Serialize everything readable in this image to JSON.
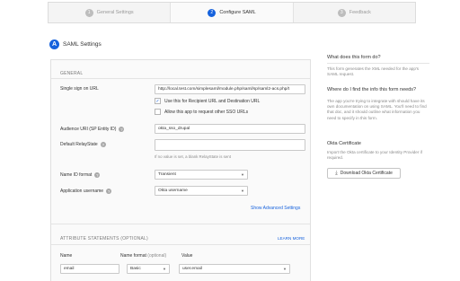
{
  "steps": [
    {
      "num": "1",
      "label": "General Settings"
    },
    {
      "num": "2",
      "label": "Configure SAML"
    },
    {
      "num": "3",
      "label": "Feedback"
    }
  ],
  "header": {
    "badge": "A",
    "title": "SAML Settings"
  },
  "general": {
    "title": "GENERAL",
    "sso_url": {
      "label": "Single sign on URL",
      "value": "http://local.test.com/simplesaml/module.php/saml/sp/saml2-acs.php/t"
    },
    "recipient_check": {
      "checked": true,
      "label": "Use this for Recipient URL and Destination URL"
    },
    "other_sso_check": {
      "checked": false,
      "label": "Allow this app to request other SSO URLs"
    },
    "audience_uri": {
      "label": "Audience URI (SP Entity ID)",
      "value": "okta_sso_drupal"
    },
    "relay_state": {
      "label": "Default RelayState",
      "value": "",
      "hint": "If no value is set, a blank RelayState is sent"
    },
    "name_id_format": {
      "label": "Name ID format",
      "value": "Transient"
    },
    "app_username": {
      "label": "Application username",
      "value": "Okta username"
    },
    "advanced_link": "Show Advanced Settings"
  },
  "attributes": {
    "title": "ATTRIBUTE STATEMENTS (OPTIONAL)",
    "learn_more": "LEARN MORE",
    "col_name": "Name",
    "col_format": "Name format",
    "col_format_opt": "(optional)",
    "col_value": "Value",
    "row": {
      "name": "email",
      "format": "Basic",
      "value": "user.email"
    }
  },
  "sidebar": {
    "q1": "What does this form do?",
    "a1": "This form generates the XML needed for the app's SAML request.",
    "q2": "Where do I find the info this form needs?",
    "a2": "The app you're trying to integrate with should have its own documentation on using SAML. You'll need to find that doc, and it should outline what information you need to specify in this form.",
    "cert_title": "Okta Certificate",
    "cert_text": "Import the Okta certificate to your Identity Provider if required.",
    "download_label": "Download Okta Certificate"
  },
  "icons": {
    "help": "help-circle-icon",
    "caret": "caret-down-icon",
    "download": "download-icon",
    "check": "checkmark-icon"
  },
  "colors": {
    "accent": "#1662dd"
  }
}
